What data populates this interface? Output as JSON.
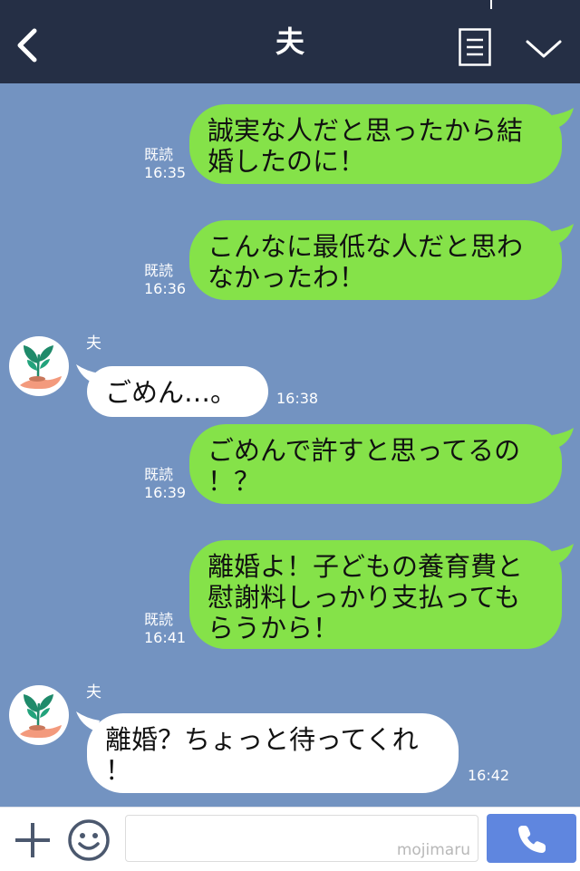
{
  "header": {
    "title": "夫"
  },
  "messages": [
    {
      "type": "out",
      "text_lines": [
        "誠実な人だと思ったから結",
        "婚したのに！"
      ],
      "read": "既読",
      "time": "16:35"
    },
    {
      "type": "out",
      "text_lines": [
        "こんなに最低な人だと思わ",
        "なかったわ！"
      ],
      "read": "既読",
      "time": "16:36"
    },
    {
      "type": "in",
      "sender": "夫",
      "text_lines": [
        "ごめん…。"
      ],
      "time": "16:38"
    },
    {
      "type": "out",
      "text_lines": [
        "ごめんで許すと思ってるの",
        "！？"
      ],
      "read": "既読",
      "time": "16:39"
    },
    {
      "type": "out",
      "text_lines": [
        "離婚よ！子どもの養育費と",
        "慰謝料しっかり支払っても",
        "らうから！"
      ],
      "read": "既読",
      "time": "16:41"
    },
    {
      "type": "in",
      "sender": "夫",
      "text_lines": [
        "離婚？ちょっと待ってくれ",
        "！"
      ],
      "time": "16:42"
    }
  ],
  "footer": {
    "watermark": "mojimaru"
  },
  "colors": {
    "header_bg": "#252f45",
    "chat_bg": "#7393c1",
    "out_bubble": "#85e249",
    "in_bubble": "#ffffff",
    "call_button": "#5f86df"
  },
  "icons": {
    "back": "chevron-left-icon",
    "menu": "menu-list-icon",
    "collapse": "chevron-down-icon",
    "add": "plus-icon",
    "sticker": "smile-icon",
    "call": "phone-icon",
    "avatar": "plant-hand-icon"
  }
}
